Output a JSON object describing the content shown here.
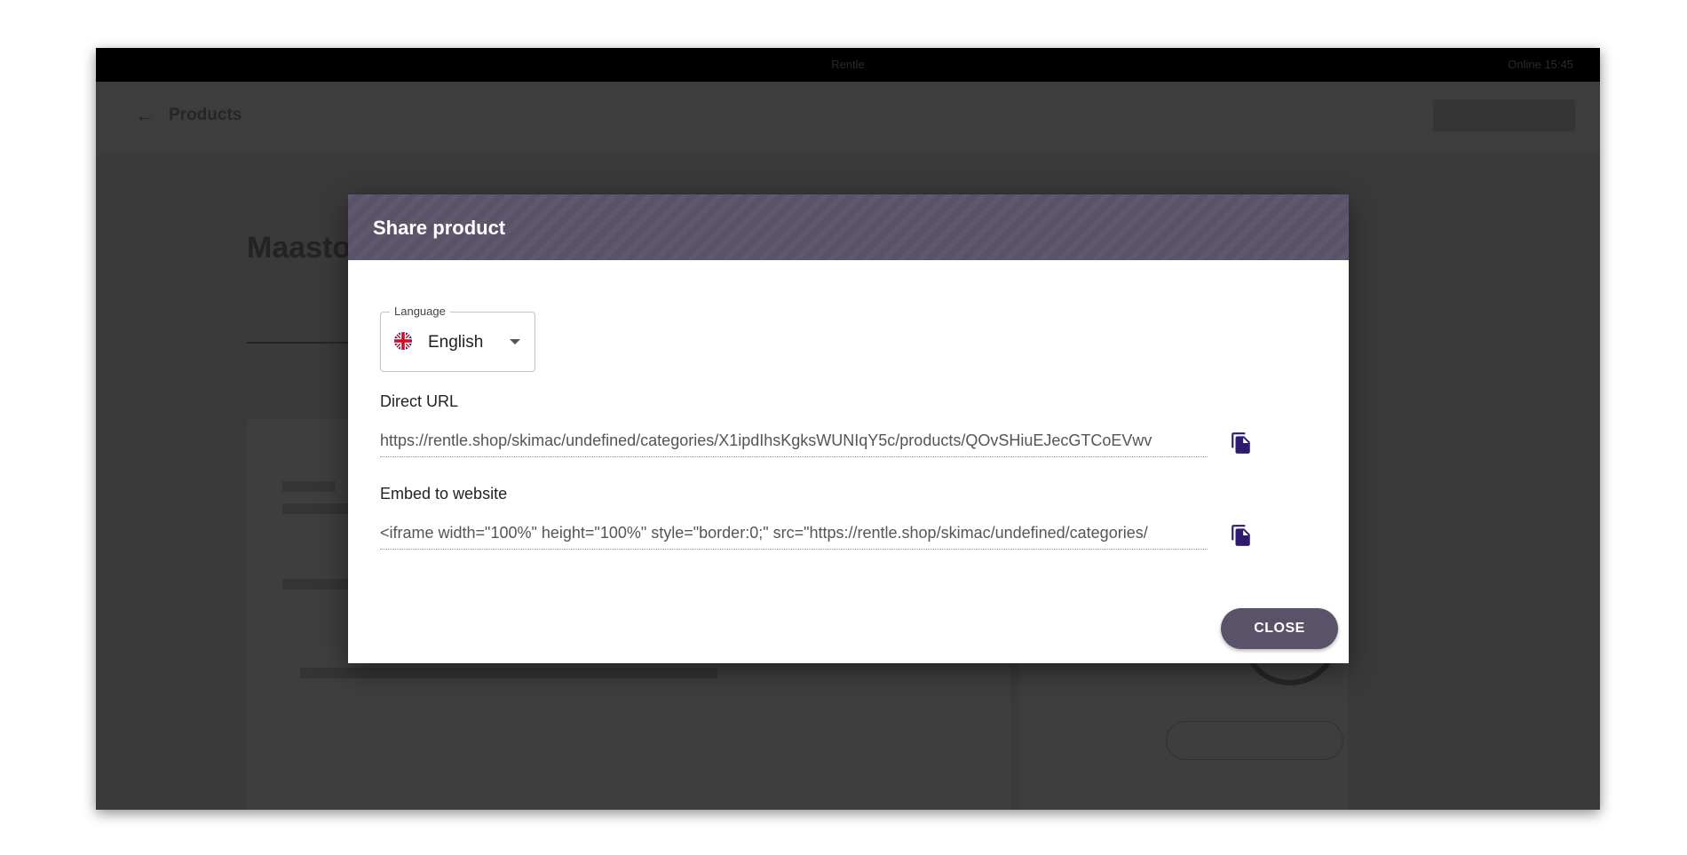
{
  "background": {
    "top_bar_label": "Rentle",
    "status": "Online   15:45",
    "header_title": "Products",
    "page_heading": "Maastoauto"
  },
  "dialog": {
    "title": "Share product",
    "language": {
      "label": "Language",
      "selected": "English",
      "flag_icon": "uk-flag-icon"
    },
    "direct_url": {
      "label": "Direct URL",
      "value": "https://rentle.shop/skimac/undefined/categories/X1ipdIhsKgksWUNIqY5c/products/QOvSHiuEJecGTCoEVwv"
    },
    "embed": {
      "label": "Embed to website",
      "value": "<iframe width=\"100%\" height=\"100%\" style=\"border:0;\" src=\"https://rentle.shop/skimac/undefined/categories/"
    },
    "copy_icon": "copy-icon",
    "close_label": "CLOSE"
  },
  "colors": {
    "accent": "#5a5268",
    "copy_icon": "#2e1a6e"
  }
}
